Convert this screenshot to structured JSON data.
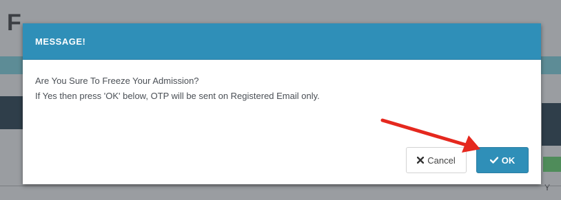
{
  "background": {
    "title_fragment": "F",
    "right_text": "Y"
  },
  "modal": {
    "title": "MESSAGE!",
    "body_lines": [
      "Are You Sure To Freeze Your Admission?",
      "If Yes then press 'OK' below, OTP will be sent on Registered Email only."
    ],
    "cancel_label": "Cancel",
    "cancel_icon": "times-icon",
    "ok_label": "OK",
    "ok_icon": "check-icon"
  },
  "colors": {
    "header": "#2f8fb8",
    "ok_button": "#2f8fb8",
    "annotation_arrow": "#e5281e"
  }
}
